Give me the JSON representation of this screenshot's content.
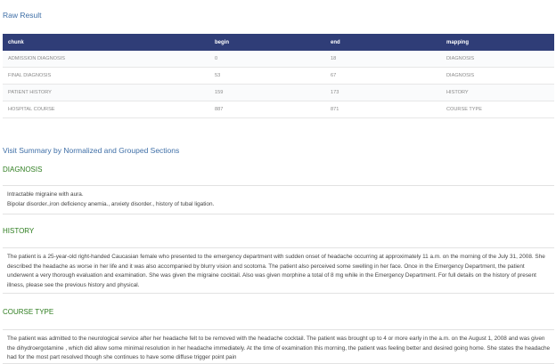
{
  "raw_result": {
    "title": "Raw Result",
    "columns": [
      "chunk",
      "begin",
      "end",
      "mapping"
    ],
    "rows": [
      [
        "ADMISSION DIAGNOSIS",
        "0",
        "18",
        "DIAGNOSIS"
      ],
      [
        "FINAL DIAGNOSIS",
        "53",
        "67",
        "DIAGNOSIS"
      ],
      [
        "PATIENT HISTORY",
        "159",
        "173",
        "HISTORY"
      ],
      [
        "HOSPITAL COURSE",
        "887",
        "871",
        "COURSE TYPE"
      ]
    ]
  },
  "summary": {
    "title": "Visit Summary by Normalized and Grouped Sections",
    "sections": [
      {
        "heading": "DIAGNOSIS",
        "lines": [
          "Intractable migraine with aura.",
          "Bipolar disorder.,iron deficiency anemia., anxiety disorder., history of tubal ligation."
        ]
      },
      {
        "heading": "HISTORY",
        "lines": [
          "The patient is a 25-year-old right-handed Caucasian female who presented to the emergency department with sudden onset of headache occurring at approximately 11 a.m. on the morning of the July 31, 2008. She described the headache as worse in her life and it was also accompanied by blurry vision and scotoma. The patient also perceived some swelling in her face. Once in the Emergency Department, the patient underwent a very thorough evaluation and examination. She was given the migraine cocktail. Also was given morphine a total of 8 mg while in the Emergency Department. For full details on the history of present illness, please see the previous history and physical."
        ]
      },
      {
        "heading": "COURSE TYPE",
        "lines": [
          "The patient was admitted to the neurological service after her headache felt to be removed with the headache cocktail. The patient was brought up to 4 or more early in the a.m. on the August 1, 2008 and was given the dihydroergotamine , which did allow some minimal resolution in her headache immediately. At the time of examination this morning, the patient was feeling better and desired going home. She states the headache had for the most part resolved though she continues to have some diffuse trigger point pain"
        ]
      }
    ]
  }
}
